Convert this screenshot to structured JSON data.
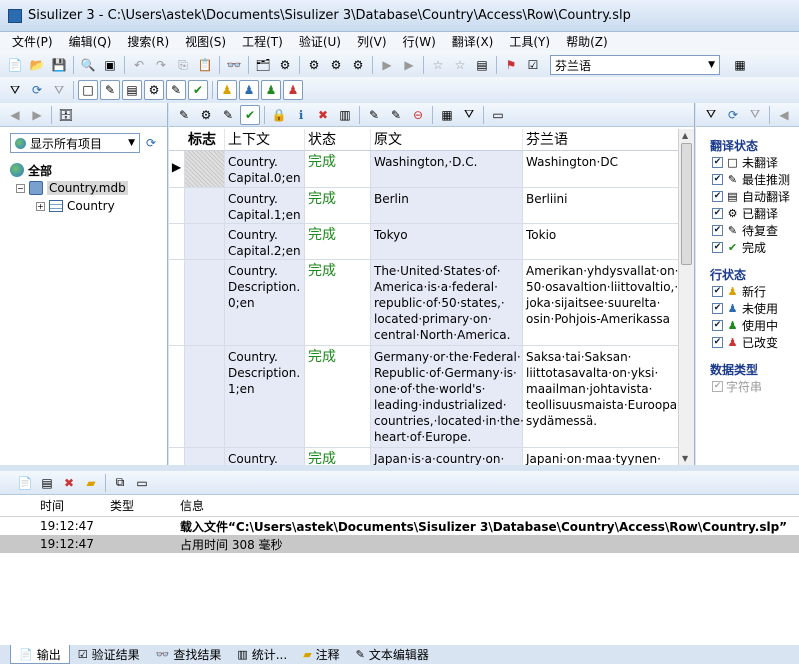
{
  "window": {
    "title": "Sisulizer 3 - C:\\Users\\astek\\Documents\\Sisulizer 3\\Database\\Country\\Access\\Row\\Country.slp"
  },
  "menu": [
    "文件(P)",
    "编辑(Q)",
    "搜索(R)",
    "视图(S)",
    "工程(T)",
    "验证(U)",
    "列(V)",
    "行(W)",
    "翻译(X)",
    "工具(Y)",
    "帮助(Z)"
  ],
  "toolbar": {
    "language": "芬兰语"
  },
  "left": {
    "filter": "显示所有项目",
    "tree": {
      "root": "全部",
      "db": "Country.mdb",
      "table": "Country"
    }
  },
  "grid": {
    "headers": {
      "flag": "标志",
      "context": "上下文",
      "state": "状态",
      "source": "原文",
      "target": "芬兰语"
    },
    "rows": [
      {
        "context": "Country. Capital.0;en",
        "state": "完成",
        "source": "Washington,·D.C.",
        "target": "Washington·DC"
      },
      {
        "context": "Country. Capital.1;en",
        "state": "完成",
        "source": "Berlin",
        "target": "Berliini"
      },
      {
        "context": "Country. Capital.2;en",
        "state": "完成",
        "source": "Tokyo",
        "target": "Tokio"
      },
      {
        "context": "Country. Description. 0;en",
        "state": "完成",
        "source": "The·United·States·of· America·is·a·federal· republic·of·50·states,· located·primary·on· central·North·America.",
        "target": "Amerikan·yhdysvallat·on· 50·osavaltion·liittovaltio,· joka·sijaitsee·suurelta· osin·Pohjois-Amerikassa"
      },
      {
        "context": "Country. Description. 1;en",
        "state": "完成",
        "source": "Germany·or·the·Federal· Republic·of·Germany·is· one·of·the·world's· leading·industrialized· countries,·located·in·the· heart·of·Europe.",
        "target": "Saksa·tai·Saksan· liittotasavalta·on·yksi· maailman·johtavista· teollisuusmaista·Euroopan· sydämessä."
      },
      {
        "context": "Country.",
        "state": "完成",
        "source": "Japan·is·a·country·on·",
        "target": "Japani·on·maa·tyynen·"
      }
    ]
  },
  "right": {
    "translate_title": "翻译状态",
    "translate_items": [
      "未翻译",
      "最佳推测",
      "自动翻译",
      "已翻译",
      "待复查",
      "完成"
    ],
    "row_title": "行状态",
    "row_items": [
      "新行",
      "未使用",
      "使用中",
      "已改变"
    ],
    "type_title": "数据类型",
    "type_items": [
      "字符串"
    ]
  },
  "output": {
    "headers": {
      "time": "时间",
      "type": "类型",
      "info": "信息"
    },
    "rows": [
      {
        "time": "19:12:47",
        "type": "",
        "info": "载入文件“C:\\Users\\astek\\Documents\\Sisulizer 3\\Database\\Country\\Access\\Row\\Country.slp”"
      },
      {
        "time": "19:12:47",
        "type": "",
        "info": "占用时间 308 毫秒"
      }
    ]
  },
  "tabs": [
    "输出",
    "验证结果",
    "查找结果",
    "统计...",
    "注释",
    "文本编辑器"
  ]
}
